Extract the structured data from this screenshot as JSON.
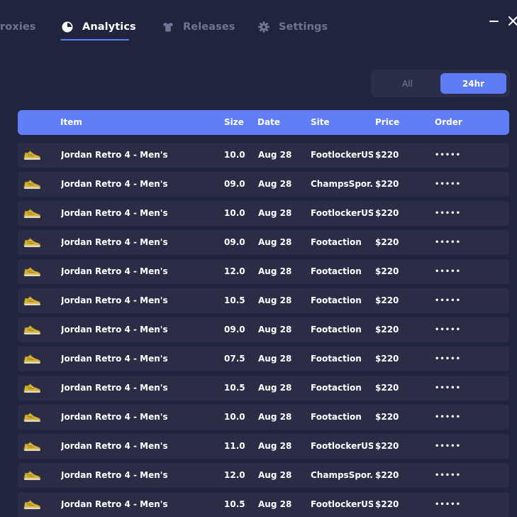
{
  "nav": {
    "tabs": [
      {
        "label": "roxies",
        "active": false,
        "icon": "none"
      },
      {
        "label": "Analytics",
        "active": true,
        "icon": "pie-chart-icon"
      },
      {
        "label": "Releases",
        "active": false,
        "icon": "shirt-icon"
      },
      {
        "label": "Settings",
        "active": false,
        "icon": "gear-icon"
      }
    ]
  },
  "window": {
    "minimize_icon": "minimize-icon",
    "close_icon": "close-icon"
  },
  "filter": {
    "options": [
      "All",
      "24hr"
    ],
    "selected": "24hr"
  },
  "table": {
    "headers": [
      "Item",
      "Size",
      "Date",
      "Site",
      "Price",
      "Order"
    ],
    "rows": [
      {
        "item": "Jordan Retro 4 - Men's",
        "size": "10.0",
        "date": "Aug 28",
        "site": "FootlockerUS",
        "price": "$220",
        "order": "•••••"
      },
      {
        "item": "Jordan Retro 4 - Men's",
        "size": "09.0",
        "date": "Aug 28",
        "site": "ChampsSpor...",
        "price": "$220",
        "order": "•••••"
      },
      {
        "item": "Jordan Retro 4 - Men's",
        "size": "10.0",
        "date": "Aug 28",
        "site": "FootlockerUS",
        "price": "$220",
        "order": "•••••"
      },
      {
        "item": "Jordan Retro 4 - Men's",
        "size": "09.0",
        "date": "Aug 28",
        "site": "Footaction",
        "price": "$220",
        "order": "•••••"
      },
      {
        "item": "Jordan Retro 4 - Men's",
        "size": "12.0",
        "date": "Aug 28",
        "site": "Footaction",
        "price": "$220",
        "order": "•••••"
      },
      {
        "item": "Jordan Retro 4 - Men's",
        "size": "10.5",
        "date": "Aug 28",
        "site": "Footaction",
        "price": "$220",
        "order": "•••••"
      },
      {
        "item": "Jordan Retro 4 - Men's",
        "size": "09.0",
        "date": "Aug 28",
        "site": "Footaction",
        "price": "$220",
        "order": "•••••"
      },
      {
        "item": "Jordan Retro 4 - Men's",
        "size": "07.5",
        "date": "Aug 28",
        "site": "Footaction",
        "price": "$220",
        "order": "•••••"
      },
      {
        "item": "Jordan Retro 4 - Men's",
        "size": "10.5",
        "date": "Aug 28",
        "site": "Footaction",
        "price": "$220",
        "order": "•••••"
      },
      {
        "item": "Jordan Retro 4 - Men's",
        "size": "10.0",
        "date": "Aug 28",
        "site": "Footaction",
        "price": "$220",
        "order": "•••••"
      },
      {
        "item": "Jordan Retro 4 - Men's",
        "size": "11.0",
        "date": "Aug 28",
        "site": "FootlockerUS",
        "price": "$220",
        "order": "•••••"
      },
      {
        "item": "Jordan Retro 4 - Men's",
        "size": "12.0",
        "date": "Aug 28",
        "site": "ChampsSpor...",
        "price": "$220",
        "order": "•••••"
      },
      {
        "item": "Jordan Retro 4 - Men's",
        "size": "10.5",
        "date": "Aug 28",
        "site": "FootlockerUS",
        "price": "$220",
        "order": "•••••"
      }
    ]
  },
  "colors": {
    "background": "#21243d",
    "row": "#2a2d45",
    "accent": "#5f7cf7",
    "muted_text": "#6e7493"
  }
}
